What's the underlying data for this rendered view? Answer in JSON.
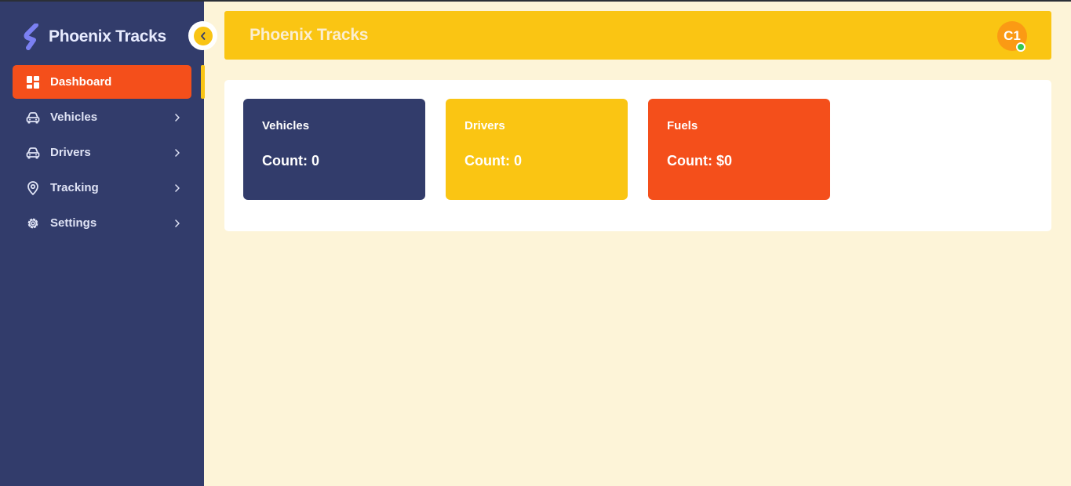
{
  "colors": {
    "sidebar_bg": "#323c6b",
    "accent_orange": "#f44f1b",
    "accent_yellow": "#fac513",
    "page_bg": "#fdf4d8",
    "avatar_bg": "#fb9a14",
    "online_dot": "#37c94e"
  },
  "brand": {
    "name": "Phoenix Tracks",
    "logo_icon": "s-logo-icon"
  },
  "sidebar": {
    "collapse_icon": "chevron-left-icon",
    "items": [
      {
        "label": "Dashboard",
        "icon": "dashboard-grid-icon",
        "active": true
      },
      {
        "label": "Vehicles",
        "icon": "car-icon",
        "active": false
      },
      {
        "label": "Drivers",
        "icon": "car-icon",
        "active": false
      },
      {
        "label": "Tracking",
        "icon": "map-pin-icon",
        "active": false
      },
      {
        "label": "Settings",
        "icon": "gear-icon",
        "active": false
      }
    ]
  },
  "header": {
    "title": "Phoenix Tracks",
    "avatar_initials": "C1",
    "status": "online"
  },
  "stats": [
    {
      "title": "Vehicles",
      "count": "Count: 0",
      "color": "#323c6b"
    },
    {
      "title": "Drivers",
      "count": "Count: 0",
      "color": "#fac513"
    },
    {
      "title": "Fuels",
      "count": "Count: $0",
      "color": "#f44f1b"
    }
  ]
}
